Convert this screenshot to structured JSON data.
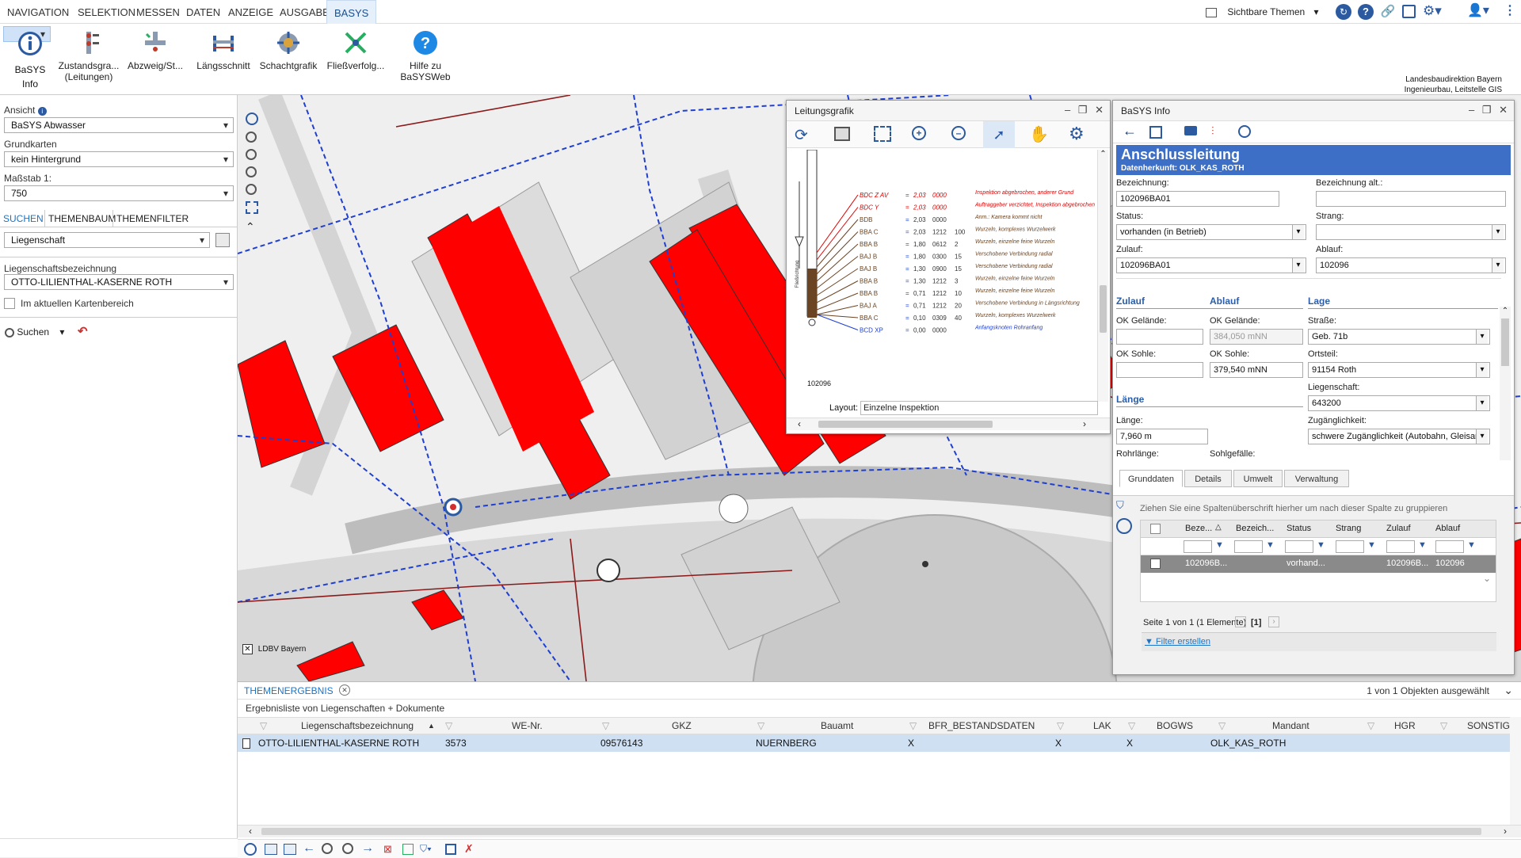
{
  "menu": [
    "NAVIGATION",
    "SELEKTION",
    "MESSEN",
    "DATEN",
    "ANZEIGE",
    "AUSGABE",
    "BASYS"
  ],
  "topright": {
    "themes_label": "Sichtbare Themen"
  },
  "ribbon": {
    "buttons": [
      {
        "label1": "BaSYS Info",
        "label2": ""
      },
      {
        "label1": "Zustandsgra...",
        "label2": "(Leitungen)"
      },
      {
        "label1": "Abzweig/St...",
        "label2": ""
      },
      {
        "label1": "Längsschnitt",
        "label2": ""
      },
      {
        "label1": "Schachtgrafik",
        "label2": ""
      },
      {
        "label1": "Fließverfolg...",
        "label2": ""
      },
      {
        "label1": "Hilfe zu",
        "label2": "BaSYSWeb"
      }
    ],
    "org_line1": "Landesbaudirektion Bayern",
    "org_line2": "Ingenieurbau, Leitstelle GIS"
  },
  "left": {
    "ansicht_label": "Ansicht",
    "ansicht_value": "BaSYS Abwasser",
    "grundkarten_label": "Grundkarten",
    "grundkarten_value": "kein Hintergrund",
    "massstab_label": "Maßstab 1:",
    "massstab_value": "750",
    "tabs": [
      "SUCHEN",
      "THEMENBAUM",
      "THEMENFILTER"
    ],
    "search_type": "Liegenschaft",
    "lieg_label": "Liegenschaftsbezeichnung",
    "lieg_value": "OTTO-LILIENTHAL-KASERNE ROTH",
    "checkbox_label": "Im aktuellen Kartenbereich",
    "search_button": "Suchen"
  },
  "map": {
    "attribution": "LDBV Bayern",
    "accent": "#ff0000",
    "pipe_color": "#1f3fd0",
    "line_color": "#8b1a1a"
  },
  "leitungsgrafik": {
    "title": "Leitungsgrafik",
    "pipe_id": "102096",
    "layout_label": "Layout:",
    "layout_value": "Einzelne Inspektion",
    "axis_label": "Fließrichtung",
    "rows": [
      {
        "code": "BDC Z AV",
        "val": "2,03",
        "pos": "0000",
        "n": "",
        "note": "Inspektion abgebrochen, anderer Grund",
        "red": true
      },
      {
        "code": "BDC Y",
        "val": "2,03",
        "pos": "0000",
        "n": "",
        "note": "Auftraggeber verzichtet, Inspektion abgebrochen",
        "red": true
      },
      {
        "code": "BDB",
        "val": "2,03",
        "pos": "0000",
        "n": "",
        "note": "Anm.: Kamera kommt nicht",
        "red": false
      },
      {
        "code": "BBA C",
        "val": "2,03",
        "pos": "1212",
        "n": "100",
        "note": "Wurzeln, komplexes Wurzelwerk",
        "red": false
      },
      {
        "code": "BBA B",
        "val": "1,80",
        "pos": "0612",
        "n": "2",
        "note": "Wurzeln, einzelne feine Wurzeln",
        "red": false
      },
      {
        "code": "BAJ B",
        "val": "1,80",
        "pos": "0300",
        "n": "15",
        "note": "Verschobene Verbindung radial",
        "red": false
      },
      {
        "code": "BAJ B",
        "val": "1,30",
        "pos": "0900",
        "n": "15",
        "note": "Verschobene Verbindung radial",
        "red": false
      },
      {
        "code": "BBA B",
        "val": "1,30",
        "pos": "1212",
        "n": "3",
        "note": "Wurzeln, einzelne feine Wurzeln",
        "red": false
      },
      {
        "code": "BBA B",
        "val": "0,71",
        "pos": "1212",
        "n": "10",
        "note": "Wurzeln, einzelne feine Wurzeln",
        "red": false
      },
      {
        "code": "BAJ A",
        "val": "0,71",
        "pos": "1212",
        "n": "20",
        "note": "Verschobene Verbindung in Längsrichtung",
        "red": false
      },
      {
        "code": "BBA C",
        "val": "0,10",
        "pos": "0309",
        "n": "40",
        "note": "Wurzeln, komplexes Wurzelwerk",
        "red": false
      },
      {
        "code": "BCD XP",
        "val": "0,00",
        "pos": "0000",
        "n": "",
        "note": "Anfangsknoten Rohranfang",
        "red": false,
        "blue": true
      }
    ]
  },
  "basys": {
    "title": "BaSYS Info",
    "heading": "Anschlussleitung",
    "source": "Datenherkunft: OLK_KAS_ROTH",
    "fields": {
      "bez_label": "Bezeichnung:",
      "bez_value": "102096BA01",
      "bezalt_label": "Bezeichnung alt.:",
      "bezalt_value": "",
      "status_label": "Status:",
      "status_value": "vorhanden (in Betrieb)",
      "strang_label": "Strang:",
      "strang_value": "",
      "zulauf_label": "Zulauf:",
      "zulauf_value": "102096BA01",
      "ablauf_label": "Ablauf:",
      "ablauf_value": "102096"
    },
    "sec_zulauf": "Zulauf",
    "sec_ablauf": "Ablauf",
    "sec_lage": "Lage",
    "sec_laenge": "Länge",
    "okg_label": "OK Gelände:",
    "okg_zu": "",
    "okg_ab": "384,050 mNN",
    "oks_label": "OK Sohle:",
    "oks_zu": "",
    "oks_ab": "379,540 mNN",
    "strasse_label": "Straße:",
    "strasse_value": "Geb. 71b",
    "ortsteil_label": "Ortsteil:",
    "ortsteil_value": "91154 Roth",
    "lieg_label": "Liegenschaft:",
    "lieg_value": "643200",
    "laenge_label": "Länge:",
    "laenge_value": "7,960 m",
    "zug_label": "Zugänglichkeit:",
    "zug_value": "schwere Zugänglichkeit (Autobahn, Gleisar",
    "rohr_label": "Rohrlänge:",
    "sohlg_label": "Sohlgefälle:",
    "tabs": [
      "Grunddaten",
      "Details",
      "Umwelt",
      "Verwaltung"
    ],
    "group_hint": "Ziehen Sie eine Spaltenüberschrift hierher um nach dieser Spalte zu gruppieren",
    "grid_headers": [
      "Beze...",
      "Bezeich...",
      "Status",
      "Strang",
      "Zulauf",
      "Ablauf"
    ],
    "grid_row": [
      "102096B...",
      "",
      "vorhand...",
      "",
      "102096B...",
      "102096"
    ],
    "pager": "Seite 1 von 1 (1 Elemente)",
    "page_current": "[1]",
    "filter_link": "Filter erstellen"
  },
  "bottom": {
    "tab": "THEMENERGEBNIS",
    "selected_info": "1 von 1 Objekten ausgewählt",
    "list_title": "Ergebnisliste von Liegenschaften + Dokumente",
    "headers": [
      "Liegenschaftsbezeichnung",
      "WE-Nr.",
      "GKZ",
      "Bauamt",
      "BFR_BESTANDSDATEN",
      "LAK",
      "BOGWS",
      "Mandant",
      "HGR",
      "SONSTIGE"
    ],
    "row": [
      "OTTO-LILIENTHAL-KASERNE ROTH",
      "3573",
      "09576143",
      "NUERNBERG",
      "X",
      "X",
      "X",
      "OLK_KAS_ROTH",
      "",
      ""
    ]
  }
}
